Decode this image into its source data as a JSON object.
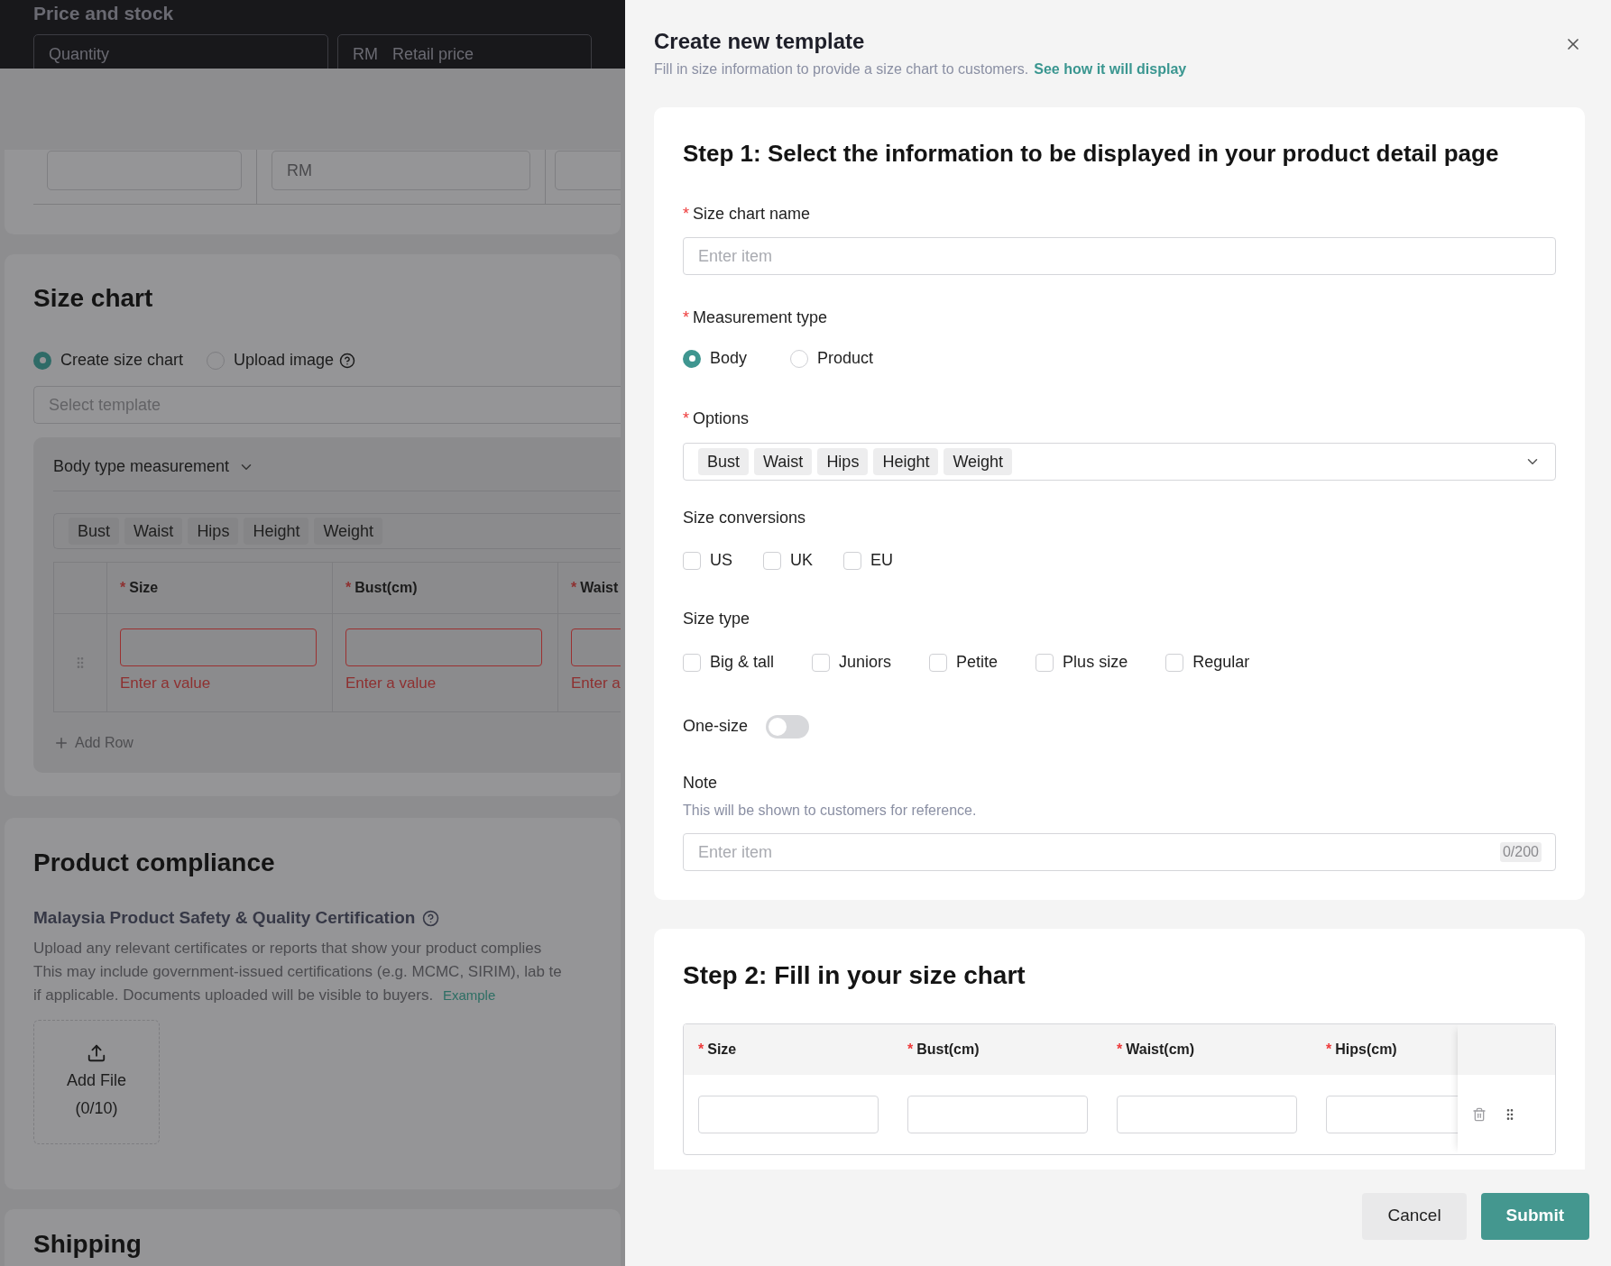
{
  "background_page": {
    "sticky_header": {
      "title": "Price and stock",
      "fields": [
        {
          "kind": "plain",
          "placeholder": "Quantity"
        },
        {
          "kind": "currency",
          "prefix": "RM",
          "placeholder": "Retail price"
        }
      ]
    },
    "price_row": {
      "fields": [
        {
          "kind": "plain"
        },
        {
          "kind": "currency",
          "prefix": "RM"
        },
        {
          "kind": "plain"
        }
      ]
    },
    "size_chart": {
      "title": "Size chart",
      "modes": [
        {
          "label": "Create size chart",
          "selected": true,
          "help": false
        },
        {
          "label": "Upload image",
          "selected": false,
          "help": true
        }
      ],
      "template_select": {
        "placeholder": "Select template"
      },
      "measurement": {
        "label": "Body type measurement"
      },
      "tags": [
        "Bust",
        "Waist",
        "Hips",
        "Height",
        "Weight"
      ],
      "table": {
        "columns": [
          {
            "mark": "*",
            "label": "Size"
          },
          {
            "mark": "*",
            "label": "Bust(cm)"
          },
          {
            "mark": "*",
            "label": "Waist"
          }
        ],
        "rows": [
          {
            "cells": [
              {
                "error": "Enter a value"
              },
              {
                "error": "Enter a value"
              },
              {
                "error": "Enter a"
              }
            ]
          }
        ]
      },
      "add_row": "Add Row"
    },
    "compliance": {
      "title": "Product compliance",
      "cert_title": "Malaysia Product Safety & Quality Certification",
      "lines": [
        "Upload any relevant certificates or reports that show your product complies",
        "This may include government-issued certifications (e.g. MCMC, SIRIM), lab te",
        "if applicable. Documents uploaded will be visible to buyers."
      ],
      "link": "Example",
      "upload": {
        "label": "Add File",
        "count": "(0/10)"
      }
    },
    "shipping": {
      "title": "Shipping"
    }
  },
  "drawer": {
    "title": "Create new template",
    "subtitle": "Fill in size information to provide a size chart to customers.",
    "subtitle_link": "See how it will display",
    "step1": {
      "heading": "Step 1: Select the information to be displayed in your product detail page",
      "name_field": {
        "mark": "*",
        "label": "Size chart name",
        "placeholder": "Enter item"
      },
      "measurement_type": {
        "mark": "*",
        "label": "Measurement type",
        "options": [
          {
            "label": "Body",
            "selected": true
          },
          {
            "label": "Product",
            "selected": false
          }
        ]
      },
      "options": {
        "mark": "*",
        "label": "Options",
        "tags": [
          "Bust",
          "Waist",
          "Hips",
          "Height",
          "Weight"
        ]
      },
      "size_conversions": {
        "label": "Size conversions",
        "items": [
          {
            "label": "US",
            "checked": false
          },
          {
            "label": "UK",
            "checked": false
          },
          {
            "label": "EU",
            "checked": false
          }
        ]
      },
      "size_type": {
        "label": "Size type",
        "items": [
          {
            "label": "Big & tall",
            "checked": false
          },
          {
            "label": "Juniors",
            "checked": false
          },
          {
            "label": "Petite",
            "checked": false
          },
          {
            "label": "Plus size",
            "checked": false
          },
          {
            "label": "Regular",
            "checked": false
          }
        ]
      },
      "one_size": {
        "label": "One-size",
        "on": false
      },
      "note": {
        "label": "Note",
        "hint": "This will be shown to customers for reference.",
        "placeholder": "Enter item",
        "counter": "0/200"
      }
    },
    "step2": {
      "heading": "Step 2: Fill in your size chart",
      "columns": [
        {
          "mark": "*",
          "label": "Size"
        },
        {
          "mark": "*",
          "label": "Bust(cm)"
        },
        {
          "mark": "*",
          "label": "Waist(cm)"
        },
        {
          "mark": "*",
          "label": "Hips(cm)"
        }
      ]
    }
  },
  "buttons": [
    {
      "label": "Cancel",
      "kind": "secondary"
    },
    {
      "label": "Submit",
      "kind": "primary"
    }
  ]
}
